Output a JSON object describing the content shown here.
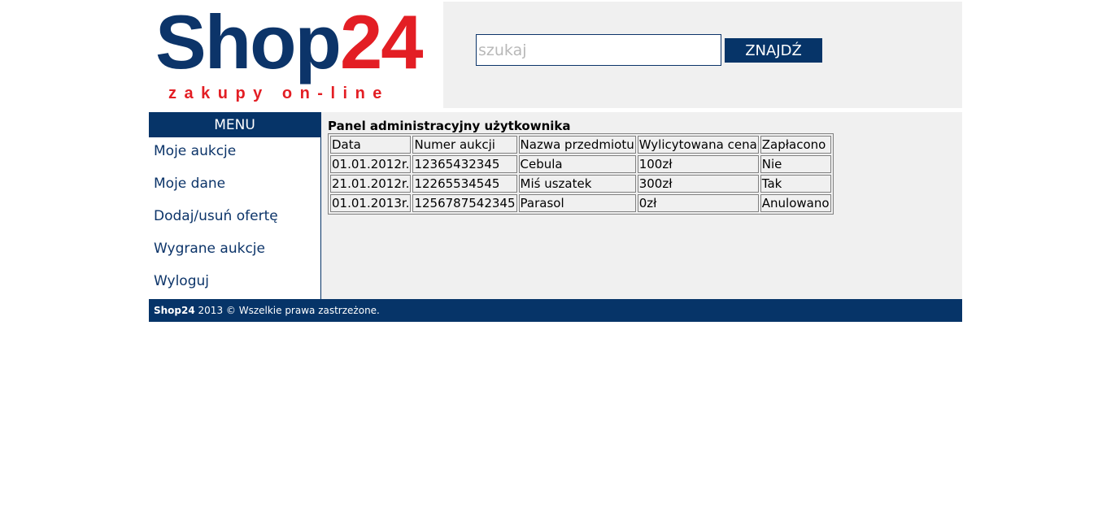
{
  "logo": {
    "name_part1": "Shop",
    "name_part2": "24",
    "tagline": "zakupy on-line",
    "colors": {
      "primary": "#0c3469",
      "accent": "#e31e24"
    }
  },
  "search": {
    "placeholder": "szukaj",
    "value": "",
    "button_label": "ZNAJDŹ"
  },
  "menu": {
    "header": "MENU",
    "items": [
      {
        "label": "Moje aukcje"
      },
      {
        "label": "Moje dane"
      },
      {
        "label": "Dodaj/usuń ofertę"
      },
      {
        "label": "Wygrane aukcje"
      },
      {
        "label": "Wyloguj"
      }
    ]
  },
  "panel": {
    "title": "Panel administracyjny użytkownika",
    "columns": [
      "Data",
      "Numer aukcji",
      "Nazwa przedmiotu",
      "Wylicytowana cena",
      "Zapłacono"
    ],
    "rows": [
      [
        "01.01.2012r.",
        "12365432345",
        "Cebula",
        "100zł",
        "Nie"
      ],
      [
        "21.01.2012r.",
        "12265534545",
        "Miś uszatek",
        "300zł",
        "Tak"
      ],
      [
        "01.01.2013r.",
        "1256787542345",
        "Parasol",
        "0zł",
        "Anulowano"
      ]
    ]
  },
  "footer": {
    "brand": "Shop24",
    "text": " 2013 © Wszelkie prawa zastrzeżone."
  },
  "theme": {
    "navy": "#063468",
    "panel_bg": "#f0f0f0"
  }
}
